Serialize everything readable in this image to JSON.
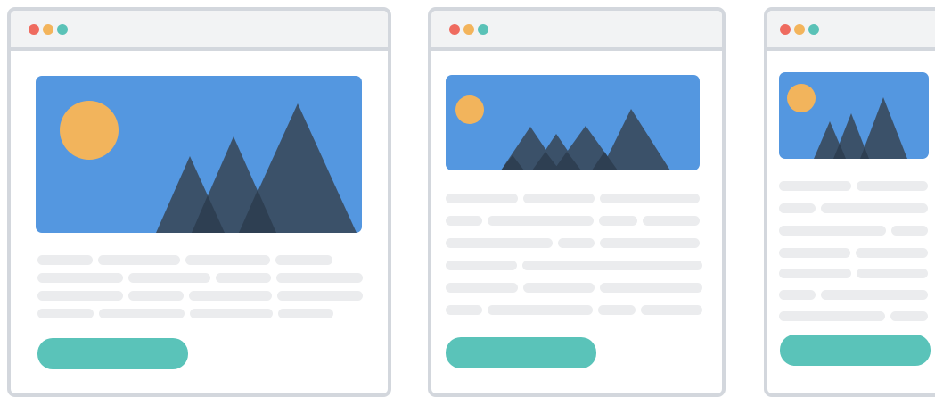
{
  "colors": {
    "frame": "#d3d7dd",
    "titlebar": "#f2f3f4",
    "dot_close": "#ef6b5f",
    "dot_minimize": "#f3b45b",
    "dot_maximize": "#5ac2b7",
    "sky": "#5497e0",
    "sun": "#f2b45c",
    "mountain": "#3b5169",
    "mountain_overlap": "#2e3f52",
    "text_placeholder": "#ebecee",
    "button": "#5ac3b9"
  },
  "mockups": [
    {
      "variant": "large",
      "icons": [
        "sun-icon",
        "mountains-icon"
      ],
      "text_line_count": 4,
      "has_button": true
    },
    {
      "variant": "medium",
      "icons": [
        "sun-icon",
        "mountains-icon"
      ],
      "text_line_count": 6,
      "has_button": true
    },
    {
      "variant": "small",
      "icons": [
        "sun-icon",
        "mountains-icon"
      ],
      "text_line_count": 7,
      "has_button": true
    }
  ]
}
